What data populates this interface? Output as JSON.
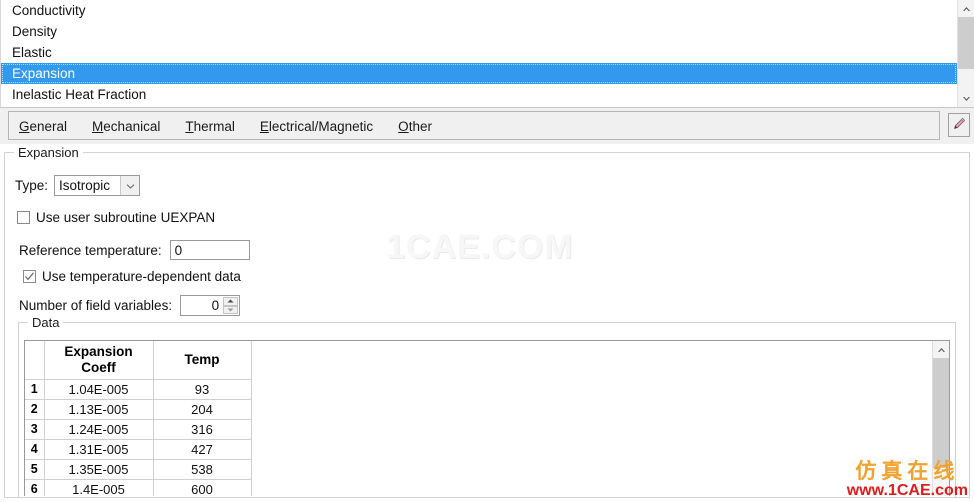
{
  "material_list": {
    "items": [
      {
        "label": "Conductivity",
        "selected": false
      },
      {
        "label": "Density",
        "selected": false
      },
      {
        "label": "Elastic",
        "selected": false
      },
      {
        "label": "Expansion",
        "selected": true
      },
      {
        "label": "Inelastic Heat Fraction",
        "selected": false
      }
    ],
    "scrollbar": {
      "up_icon": "chevron-up-icon",
      "down_icon": "chevron-down-icon"
    }
  },
  "tabs": [
    {
      "label": "General",
      "mnemonic": "G",
      "rest": "eneral"
    },
    {
      "label": "Mechanical",
      "mnemonic": "M",
      "rest": "echanical"
    },
    {
      "label": "Thermal",
      "mnemonic": "T",
      "rest": "hermal"
    },
    {
      "label": "Electrical/Magnetic",
      "mnemonic": "E",
      "rest": "lectrical/Magnetic"
    },
    {
      "label": "Other",
      "mnemonic": "O",
      "rest": "ther"
    }
  ],
  "toolbar": {
    "edit_icon": "pencil-icon"
  },
  "expansion": {
    "group_title": "Expansion",
    "type_label": "Type:",
    "type_value": "Isotropic",
    "subroutine_label": "Use user subroutine UEXPAN",
    "subroutine_checked": false,
    "reference_temperature_label": "Reference temperature:",
    "reference_temperature_value": "0",
    "temp_dependent_label": "Use temperature-dependent data",
    "temp_dependent_checked": true,
    "field_variables_label": "Number of field variables:",
    "field_variables_value": "0"
  },
  "data_group": {
    "group_title": "Data",
    "columns": [
      "Expansion\nCoeff",
      "Temp"
    ],
    "column_lines": [
      [
        "Expansion",
        "Coeff"
      ],
      [
        "Temp",
        ""
      ]
    ],
    "rows": [
      {
        "n": "1",
        "coeff": "1.04E-005",
        "temp": "93"
      },
      {
        "n": "2",
        "coeff": "1.13E-005",
        "temp": "204"
      },
      {
        "n": "3",
        "coeff": "1.24E-005",
        "temp": "316"
      },
      {
        "n": "4",
        "coeff": "1.31E-005",
        "temp": "427"
      },
      {
        "n": "5",
        "coeff": "1.35E-005",
        "temp": "538"
      },
      {
        "n": "6",
        "coeff": "1.4E-005",
        "temp": "600"
      }
    ]
  },
  "watermarks": {
    "center": "1CAE.COM",
    "bottom_cn": "仿真在线",
    "bottom_url": "www.1CAE.com"
  },
  "colors": {
    "selection": "#3399ee",
    "watermark_orange": "#f0a22e",
    "watermark_red": "#e01b1b"
  }
}
